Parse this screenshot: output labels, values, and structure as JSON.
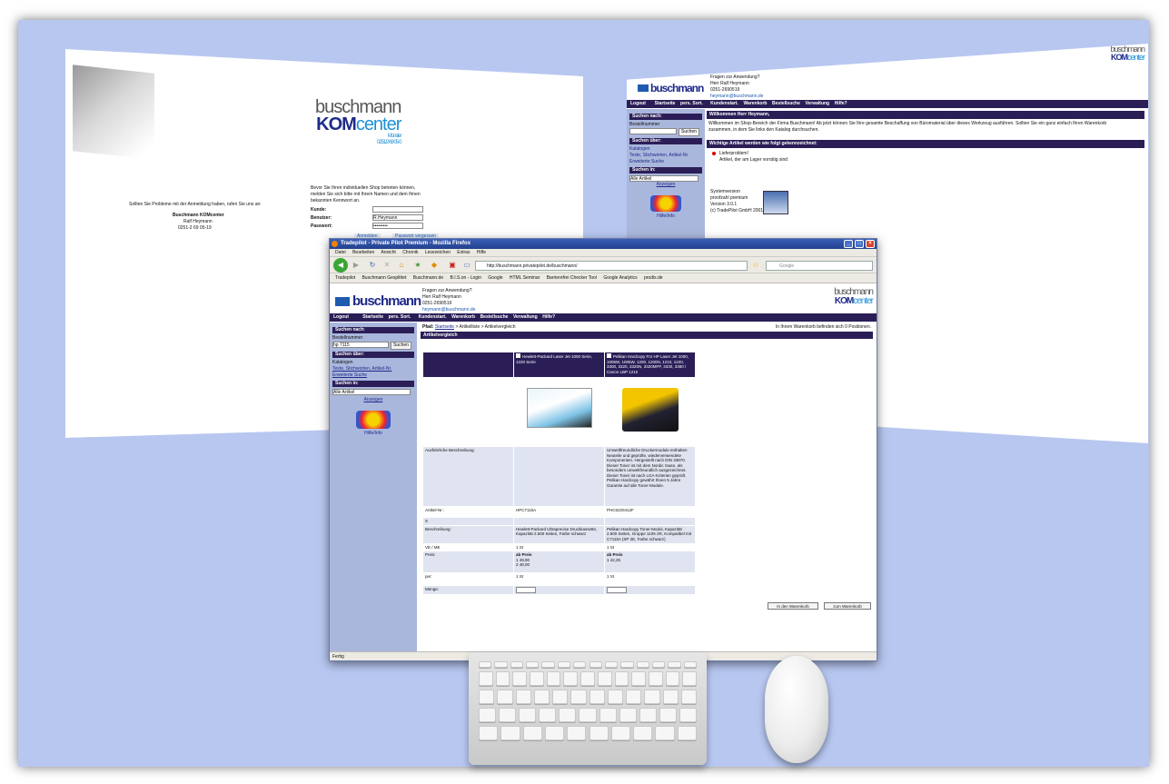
{
  "left_panel": {
    "logo_top": "buschmann",
    "logo_kom": "KOM",
    "logo_center": "center",
    "logo_city": "Münster",
    "logo_phone": "0251/2 69 05-0",
    "login_problem": "Sollten Sie Probleme mit der Anmeldung haben, rufen Sie uns an:",
    "company": "Buschmann KOMcenter",
    "contact": "Ralf Heymann",
    "phone": "0251-2 69 05-19",
    "login_intro": "Bevor Sie Ihren individuellen Shop betreten können, melden Sie sich bitte mit Ihrem Namen und dem Ihnen bekannten Kennwort an.",
    "label_kunde": "Kunde:",
    "label_benutzer": "Benutzer:",
    "label_passwort": "Passwort:",
    "value_benutzer": "R.Heymann",
    "value_passwort": "•••••••••",
    "btn_anmelden": "Anmelden",
    "btn_vergessen": "Passwort vergessen"
  },
  "right_panel": {
    "logo_top": "buschmann",
    "logo_kom": "KOM",
    "logo_center": "center",
    "brand": "buschmann",
    "contact_lines": [
      "Fragen zur Anwendung?",
      "Herr Ralf Heymann",
      "0251-2690519",
      "heymann@buschmann.de"
    ],
    "nav": [
      "Logout",
      "Startseite",
      "pers. Sort.",
      "Kundenstart.",
      "Warenkorb",
      "Bestellsuche",
      "Verwaltung",
      "Hilfe?"
    ],
    "welcome_head": "Willkommen Herr Heymann,",
    "welcome_text": "Willkommen im Shop-Bereich der Firma Buschmann! Ab jetzt können Sie Ihre gesamte Beschaffung von Büromaterial über dieses Werkzeug ausführen. Sollten Sie ein ganz einfach Ihren Warenkorb zusammen, in dem Sie links den Katalog durchsuchen.",
    "notice_head": "Wichtige Artikel werden wie folgt gekennzeichnet:",
    "notice_lines": [
      "Lieferproblem!",
      "Artikel, der am Lager vorrätig sind"
    ],
    "system_lines": [
      "Systemversion",
      "proofzahl premium",
      "Version 3.0.1",
      "(c) TradePilot GmbH 2001-2008"
    ],
    "side_search": "Suchen nach:",
    "side_search_sub": "Bestellnummer",
    "side_btn": "Suchen",
    "side_ueber": "Suchen über:",
    "side_links": [
      "Katalogen",
      "Texte, Stichworten, Artikel-Nr.",
      "Erweiterte Suche"
    ],
    "side_in": "Suchen in:",
    "side_select": "Alle Artikel",
    "side_anzeigen": "Anzeigen",
    "side_hilfe": "Hilfe/Info"
  },
  "browser": {
    "title": "Tradepilot - Private Pilot Premium - Mozilla Firefox",
    "menu": [
      "Datei",
      "Bearbeiten",
      "Ansicht",
      "Chronik",
      "Lesezeichen",
      "Extras",
      "Hilfe"
    ],
    "url": "http://buschmann.privatepilot.de/buschmann/",
    "search_placeholder": "Google",
    "bookmarks": [
      "Tradepilot",
      "Buschmann Gesplittet",
      "Buschmann.de",
      "B.I.S.on - Login",
      "Google",
      "HTML Seminar",
      "Barrierefrei Checker Tool",
      "Google Analytics",
      "prodis.de"
    ],
    "status": "Fertig"
  },
  "site": {
    "brand": "buschmann",
    "contact_lines": [
      "Fragen zur Anwendung?",
      "Herr Ralf Heymann",
      "0251-2690519",
      "heymann@buschmann.de"
    ],
    "logo_top": "buschmann",
    "logo_kom": "KOM",
    "logo_center": "center",
    "nav": [
      "Logout",
      "Startseite",
      "pers. Sort.",
      "Kundenstart.",
      "Warenkorb",
      "Bestellsuche",
      "Verwaltung",
      "Hilfe?"
    ],
    "breadcrumb_pfad": "Pfad:",
    "breadcrumb_start": "Startseite",
    "breadcrumb_rest": "> Artikelliste > Artikelvergleich",
    "cart_info": "In Ihrem Warenkorb befinden sich 0 Positionen.",
    "section": "Artikelvergleich",
    "side_search": "Suchen nach:",
    "side_search_sub": "Bestellnummer",
    "side_value": "hp 7115",
    "side_btn": "Suchen",
    "side_ueber": "Suchen über:",
    "side_links": [
      "Katalogen",
      "Texte, Stichworten, Artikel-Nr.",
      "Erweiterte Suche"
    ],
    "side_in": "Suchen in:",
    "side_select": "Alle Artikel",
    "side_anzeigen": "Anzeigen",
    "side_hilfe": "Hilfe/Info",
    "product1_name": "Hewlett-Packard Laser Jet 1000 Serie, 1220 Serie",
    "product2_name": "Pelikan Hardcopy Für HP Laser Jet 1000, 1005W, 1005W, 1200, 1200N, 1210, 1220, 3300, 3320, 3320N, 3320MFP, 3330, 3380 / Canon LBP 1210",
    "row_beschreibung": "Ausführliche Beschreibung:",
    "product2_desc": "Umweltfreundliche Druckermodule enthalten Neuteile und geprüfte, wiederverwendete Komponenten. Hergestellt nach DIN 33870. Dieser Toner ist mit dem Nordic Swan, als besonders umweltfreundlich ausgezeichnet. Dieser Toner ist nach LGA-Kriterien geprüft. Pelikan Hardcopy gewährt Ihnen 5 Jahre Garantie auf alle Toner-Module.",
    "row_artikel": "Artikel-Nr.:",
    "product1_nr": "HPC7115A",
    "product2_nr": "PHC6220412F",
    "row_x": "X",
    "row_bezeichnung": "Beschreibung:",
    "product1_bez": "Hewlett-Packard Ultraprecise Druckkassette, Kapazität 2.500 Seiten, Farbe schwarz",
    "product2_bez": "Pelikan Hardcopy Toner-Modul, Kapazität 2.500 Seiten, Gruppe 1105 2R, Kompatibel mit C7115A (SP 2E, Farbe schwarz)",
    "row_ve": "VE / ME",
    "product1_ve": "1 St",
    "product2_ve": "1 St",
    "row_preis": "Preis:",
    "preis_head": "ab Preis",
    "product1_preise": [
      "1  49,90",
      "2  48,00"
    ],
    "product2_preise": [
      "1  42,25"
    ],
    "row_per": "per:",
    "product1_per": "1 St",
    "product2_per": "1 St",
    "row_menge": "Menge:",
    "btn_warenkorb": "In den Warenkorb",
    "btn_zum": "zum Warenkorb"
  }
}
